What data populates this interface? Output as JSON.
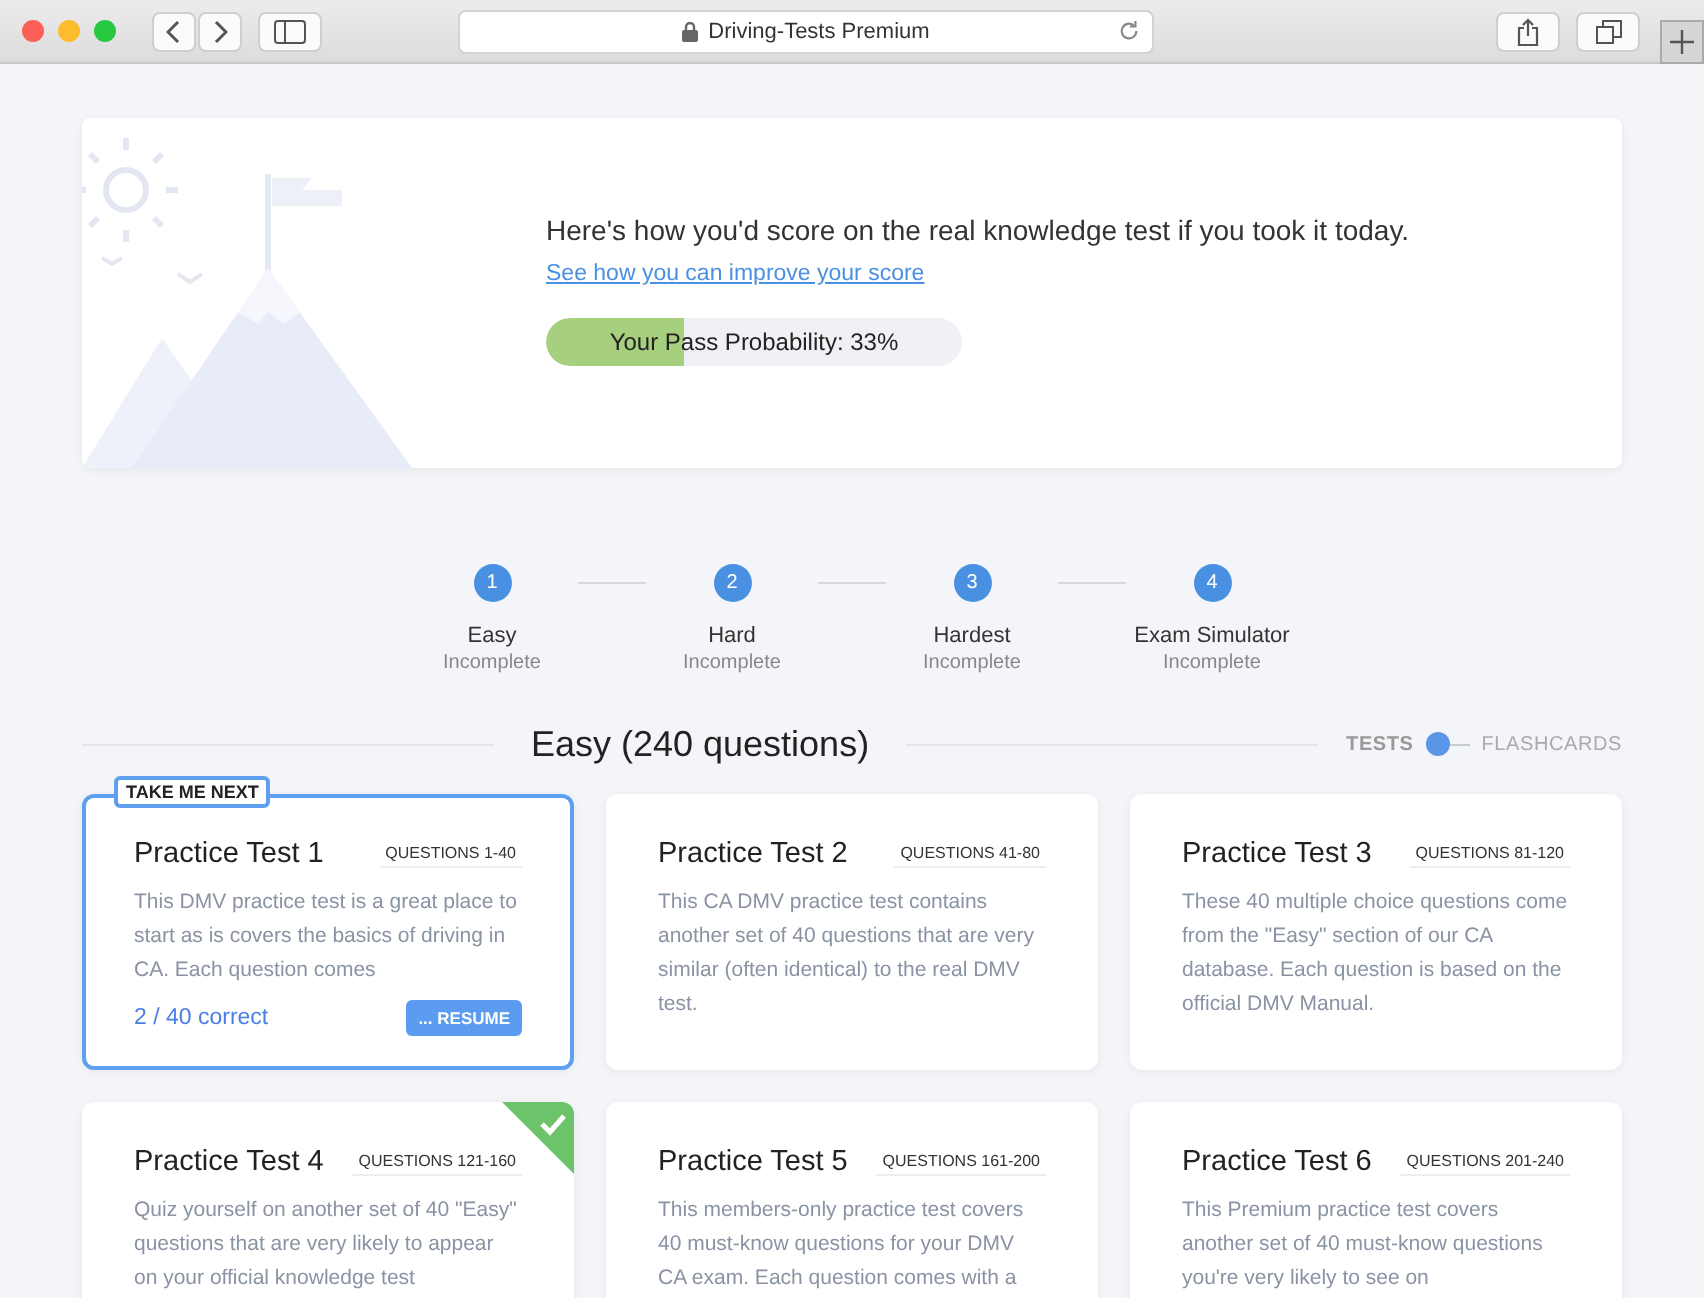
{
  "browser": {
    "address": "Driving-Tests Premium"
  },
  "hero": {
    "heading": "Here's how you'd score on the real knowledge test if you took it today.",
    "link": "See how you can improve your score",
    "probability": {
      "label": "Your Pass Probability: 33%",
      "level": 0.33
    }
  },
  "steps": [
    {
      "number": "1",
      "label": "Easy",
      "status": "Incomplete"
    },
    {
      "number": "2",
      "label": "Hard",
      "status": "Incomplete"
    },
    {
      "number": "3",
      "label": "Hardest",
      "status": "Incomplete"
    },
    {
      "number": "4",
      "label": "Exam Simulator",
      "status": "Incomplete"
    }
  ],
  "section": {
    "title": "Easy (240 questions)",
    "view_toggle": [
      {
        "label": "TESTS",
        "selected": true
      },
      {
        "label": "FLASHCARDS",
        "selected": false
      }
    ]
  },
  "cards": [
    {
      "title": "Practice Test 1",
      "range": "QUESTIONS 1-40",
      "description": "This DMV practice test is a great place to start as is covers the basics of driving in CA. Each question comes",
      "tag": "TAKE ME NEXT",
      "highlighted": true,
      "completed": false,
      "progress": "2 / 40 correct",
      "button": "... RESUME"
    },
    {
      "title": "Practice Test 2",
      "range": "QUESTIONS 41-80",
      "description": "This CA DMV practice test contains another set of 40 questions that are very similar (often identical) to the real DMV test.",
      "highlighted": false,
      "completed": false
    },
    {
      "title": "Practice Test 3",
      "range": "QUESTIONS 81-120",
      "description": "These 40 multiple choice questions come from the \"Easy\" section of our CA database. Each question is based on the official DMV Manual.",
      "highlighted": false,
      "completed": false
    },
    {
      "title": "Practice Test 4",
      "range": "QUESTIONS 121-160",
      "description": "Quiz yourself on another set of 40 \"Easy\" questions that are very likely to appear on your official knowledge test",
      "highlighted": false,
      "completed": true
    },
    {
      "title": "Practice Test 5",
      "range": "QUESTIONS 161-200",
      "description": "This members-only practice test covers 40 must-know questions for your DMV CA exam. Each question comes with a",
      "highlighted": false,
      "completed": false
    },
    {
      "title": "Practice Test 6",
      "range": "QUESTIONS 201-240",
      "description": "This Premium practice test covers another set of 40 must-know questions you're very likely to see on",
      "highlighted": false,
      "completed": false
    }
  ]
}
